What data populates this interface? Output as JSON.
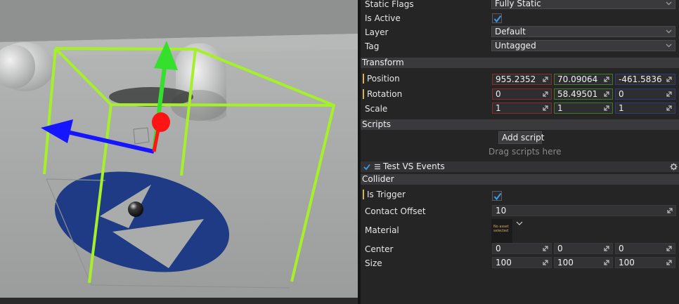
{
  "viewport": {
    "scene": "3D scene view with a box collider, transform gizmo and floor decal"
  },
  "inspector": {
    "static_flags": {
      "label": "Static Flags",
      "value": "Fully Static"
    },
    "is_active": {
      "label": "Is Active",
      "checked": true
    },
    "layer": {
      "label": "Layer",
      "value": "Default"
    },
    "tag": {
      "label": "Tag",
      "value": "Untagged"
    },
    "transform": {
      "header": "Transform",
      "position": {
        "label": "Position",
        "x": "955.2352",
        "y": "70.09064",
        "z": "-461.5836"
      },
      "rotation": {
        "label": "Rotation",
        "x": "0",
        "y": "58.49501",
        "z": "0"
      },
      "scale": {
        "label": "Scale",
        "x": "1",
        "y": "1",
        "z": "1"
      }
    },
    "scripts": {
      "header": "Scripts",
      "add_button": "Add script",
      "drop_hint": "Drag scripts here",
      "items": [
        {
          "name": "Test VS Events",
          "enabled": true
        }
      ]
    },
    "collider": {
      "header": "Collider",
      "is_trigger": {
        "label": "Is Trigger",
        "checked": true
      },
      "contact_offset": {
        "label": "Contact Offset",
        "value": "10"
      },
      "material": {
        "label": "Material",
        "thumb_text": "No asset selected"
      },
      "center": {
        "label": "Center",
        "x": "0",
        "y": "0",
        "z": "0"
      },
      "size": {
        "label": "Size",
        "x": "100",
        "y": "100",
        "z": "100"
      }
    }
  },
  "colors": {
    "panel_bg": "#252526",
    "header_bg": "#3a3a3d",
    "x_axis": "#8c2b2b",
    "y_axis": "#3f7a2a",
    "z_axis": "#2c3c7c",
    "collider_wire": "#a6f02a"
  }
}
